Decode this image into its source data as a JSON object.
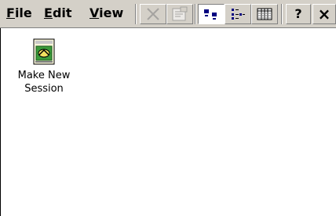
{
  "menu": {
    "file": {
      "underline": "F",
      "rest": "ile"
    },
    "edit": {
      "underline": "E",
      "rest": "dit"
    },
    "view": {
      "underline": "V",
      "rest": "iew"
    }
  },
  "toolbar": {
    "buttons": [
      {
        "name": "delete-button",
        "icon": "x-icon",
        "state": "disabled"
      },
      {
        "name": "properties-button",
        "icon": "properties-icon",
        "state": "disabled"
      },
      {
        "name": "large-icons-view-button",
        "icon": "large-icons-icon",
        "state": "pressed"
      },
      {
        "name": "small-icons-view-button",
        "icon": "small-icons-icon",
        "state": "raised"
      },
      {
        "name": "details-view-button",
        "icon": "details-icon",
        "state": "raised"
      }
    ],
    "help_label": "?",
    "close_label": "×"
  },
  "content": {
    "items": [
      {
        "label": "Make New Session",
        "icon": "make-new-session-icon"
      }
    ]
  },
  "colors": {
    "toolbar_bg": "#d4d0c8",
    "shadow": "#808080",
    "highlight": "#ffffff",
    "selection_blue": "#000080",
    "icon_green": "#3a9a3a",
    "icon_yellow": "#f0e060"
  }
}
